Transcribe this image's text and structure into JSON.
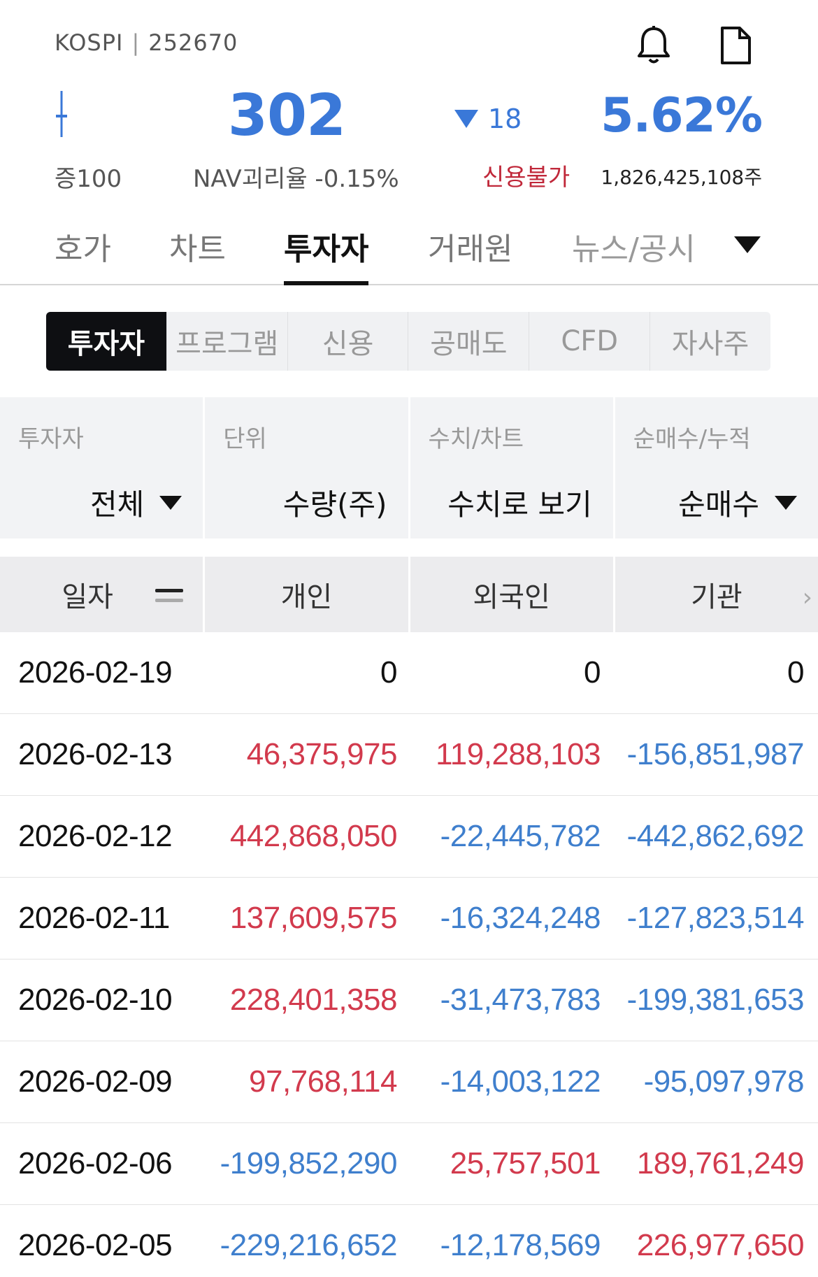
{
  "header": {
    "market": "KOSPI",
    "separator": "|",
    "code": "252670",
    "price": "302",
    "change_value": "18",
    "change_rate": "5.62%",
    "margin_label": "증100",
    "nav_divergence": "NAV괴리율 -0.15%",
    "credit_status": "신용불가",
    "shares_outstanding": "1,826,425,108주",
    "icons": [
      "bell-icon",
      "document-icon",
      "candlestick-icon",
      "triangle-down-icon"
    ],
    "colors": {
      "down": "#3a78d8",
      "credit": "#c0283a"
    }
  },
  "main_tabs": [
    {
      "label": "호가",
      "active": false
    },
    {
      "label": "차트",
      "active": false
    },
    {
      "label": "투자자",
      "active": true
    },
    {
      "label": "거래원",
      "active": false
    },
    {
      "label": "뉴스/공시",
      "active": false
    }
  ],
  "sub_tabs": [
    {
      "label": "투자자",
      "active": true
    },
    {
      "label": "프로그램",
      "active": false
    },
    {
      "label": "신용",
      "active": false
    },
    {
      "label": "공매도",
      "active": false
    },
    {
      "label": "CFD",
      "active": false
    },
    {
      "label": "자사주",
      "active": false
    }
  ],
  "filters": [
    {
      "caption": "투자자",
      "value": "전체",
      "dropdown": true
    },
    {
      "caption": "단위",
      "value": "수량(주)",
      "dropdown": false
    },
    {
      "caption": "수치/차트",
      "value": "수치로 보기",
      "dropdown": false
    },
    {
      "caption": "순매수/누적",
      "value": "순매수",
      "dropdown": true
    }
  ],
  "table": {
    "headers": [
      "일자",
      "개인",
      "외국인",
      "기관"
    ],
    "rows": [
      [
        "2026-02-19",
        "0",
        "0",
        "0"
      ],
      [
        "2026-02-13",
        "46,375,975",
        "119,288,103",
        "-156,851,987"
      ],
      [
        "2026-02-12",
        "442,868,050",
        "-22,445,782",
        "-442,862,692"
      ],
      [
        "2026-02-11",
        "137,609,575",
        "-16,324,248",
        "-127,823,514"
      ],
      [
        "2026-02-10",
        "228,401,358",
        "-31,473,783",
        "-199,381,653"
      ],
      [
        "2026-02-09",
        "97,768,114",
        "-14,003,122",
        "-95,097,978"
      ],
      [
        "2026-02-06",
        "-199,852,290",
        "25,757,501",
        "189,761,249"
      ],
      [
        "2026-02-05",
        "-229,216,652",
        "-12,178,569",
        "226,977,650"
      ]
    ],
    "colors": {
      "positive": "#d23a4d",
      "negative": "#3f7fcd"
    }
  }
}
